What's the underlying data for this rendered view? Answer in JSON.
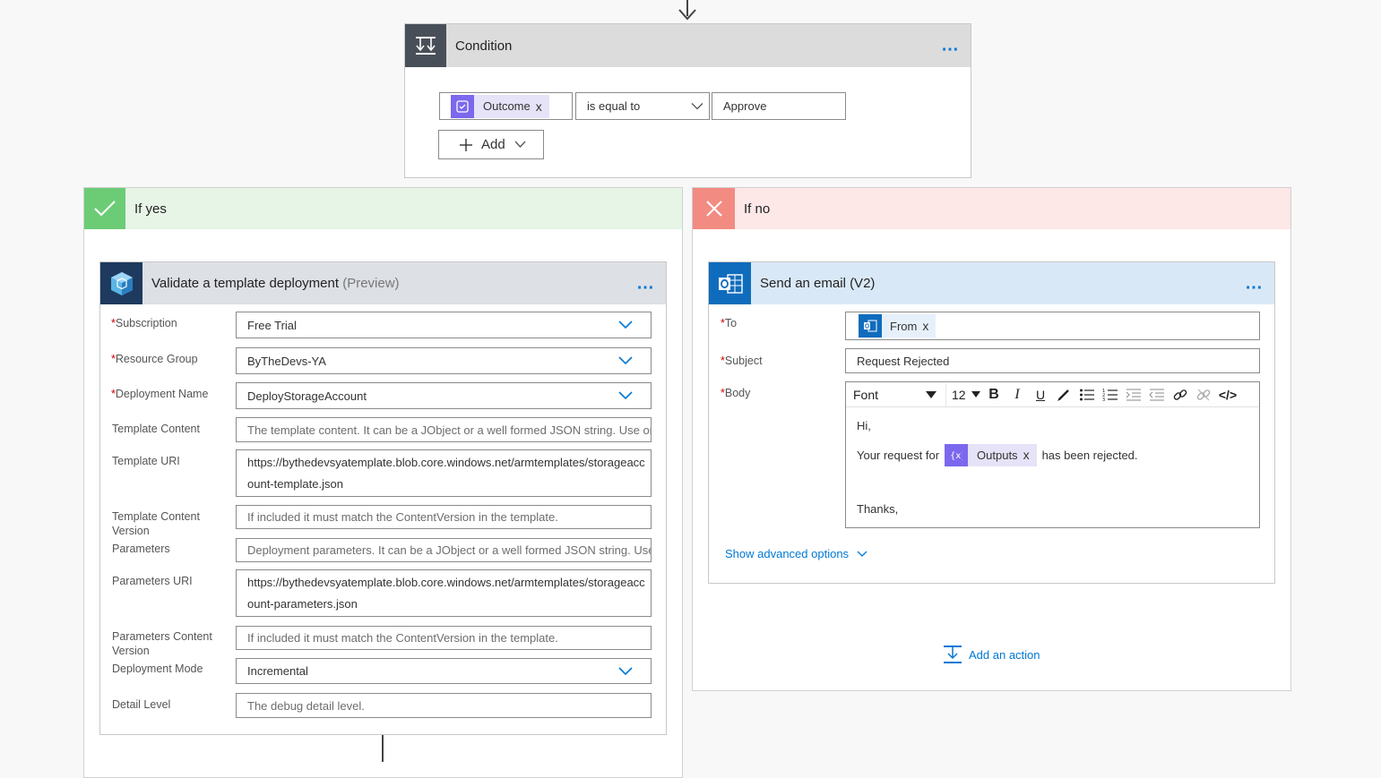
{
  "condition": {
    "title": "Condition",
    "token_label": "Outcome",
    "token_remove": "x",
    "operator": "is equal to",
    "value": "Approve",
    "add_label": "Add",
    "menu": "…"
  },
  "if_yes": {
    "label": "If yes",
    "action": {
      "title": "Validate a template deployment",
      "title_suffix": "(Preview)",
      "menu": "…",
      "fields": [
        {
          "label": "Subscription",
          "required": "*",
          "value": "Free Trial"
        },
        {
          "label": "Resource Group",
          "required": "*",
          "value": "ByTheDevs-YA"
        },
        {
          "label": "Deployment Name",
          "required": "*",
          "value": "DeployStorageAccount"
        },
        {
          "label": "Template Content",
          "placeholder": "The template content. It can be a JObject or a well formed JSON string. Use onl"
        },
        {
          "label": "Template URI",
          "value_line1": "https://bythedevsyatemplate.blob.core.windows.net/armtemplates/storageacc",
          "value_line2": "ount-template.json"
        },
        {
          "label_line1": "Template Content",
          "label_line2": "Version",
          "placeholder": "If included it must match the ContentVersion in the template."
        },
        {
          "label": "Parameters",
          "placeholder": "Deployment parameters. It can be a JObject or a well formed JSON string. Use c"
        },
        {
          "label": "Parameters URI",
          "value_line1": "https://bythedevsyatemplate.blob.core.windows.net/armtemplates/storageacc",
          "value_line2": "ount-parameters.json"
        },
        {
          "label_line1": "Parameters Content",
          "label_line2": "Version",
          "placeholder": "If included it must match the ContentVersion in the template."
        },
        {
          "label": "Deployment Mode",
          "value": "Incremental"
        },
        {
          "label": "Detail Level",
          "placeholder": "The debug detail level."
        }
      ]
    }
  },
  "if_no": {
    "label": "If no",
    "action": {
      "title": "Send an email (V2)",
      "menu": "…",
      "to_label": "To",
      "to_token": "From",
      "subject_label": "Subject",
      "subject_value": "Request Rejected",
      "body_label": "Body",
      "required": "*",
      "token_remove": "x",
      "toolbar": {
        "font": "Font",
        "size": "12",
        "bold": "B",
        "italic": "I",
        "underline": "U",
        "code": "</>"
      },
      "body": {
        "greeting": "Hi,",
        "line_prefix": "Your request for",
        "token": "Outputs",
        "line_suffix": "has been rejected.",
        "closing": "Thanks,"
      },
      "advanced_options": "Show advanced options"
    },
    "add_action": "Add an action"
  },
  "colors": {
    "accent": "#0078d4",
    "yes_bg": "#e6f5e6",
    "yes_icon": "#6ccc76",
    "no_bg": "#fde7e7",
    "no_icon": "#f28b82",
    "condition_header": "#dcdcdc",
    "condition_icon": "#484f58",
    "arm_header": "#dde0e5",
    "arm_icon": "#1e3a5f",
    "email_header": "#d9e8f7",
    "email_icon": "#0f6cbd",
    "token_bg": "#e6e2f7",
    "token_icon": "#7b68ee"
  }
}
